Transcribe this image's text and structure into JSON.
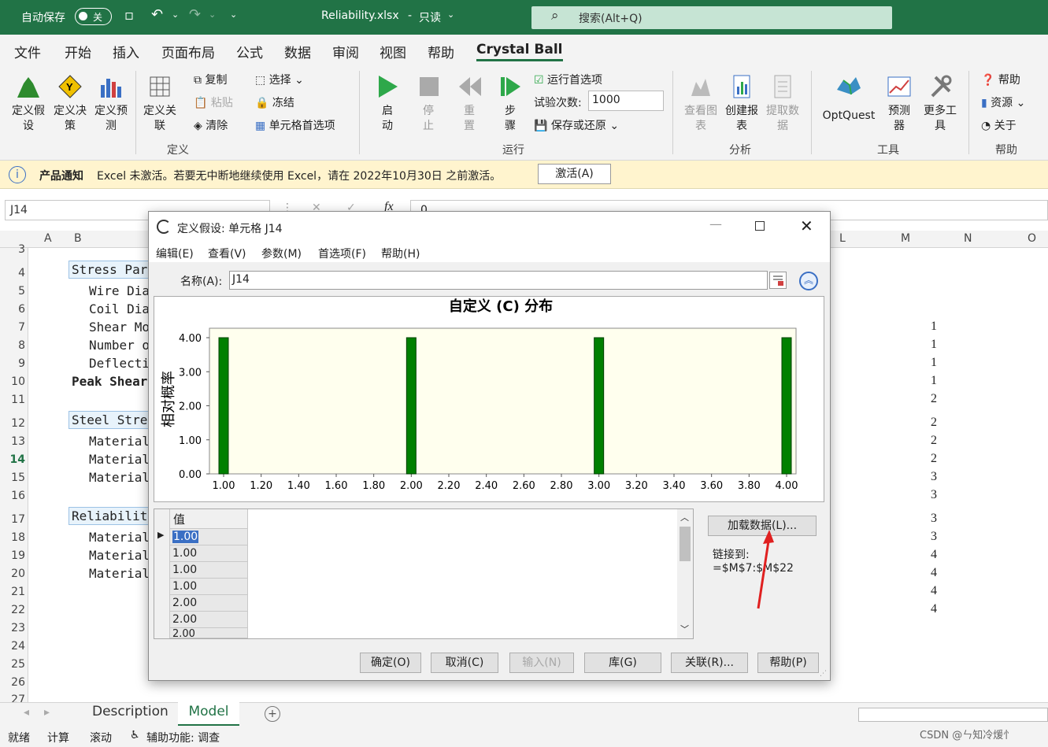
{
  "titlebar": {
    "autosave_label": "自动保存",
    "autosave_state": "关",
    "filename": "Reliability.xlsx",
    "separator": "-",
    "readonly": "只读",
    "search_placeholder": "搜索(Alt+Q)"
  },
  "menu": [
    "文件",
    "开始",
    "插入",
    "页面布局",
    "公式",
    "数据",
    "审阅",
    "视图",
    "帮助",
    "Crystal Ball"
  ],
  "ribbon": {
    "define": {
      "btn1": "定义假设",
      "btn1b": "设",
      "btn2": "定义决策",
      "btn3": "定义预测",
      "btn4": "定义关联",
      "copy": "复制",
      "paste": "粘贴",
      "clear": "清除",
      "select": "选择",
      "freeze": "冻结",
      "cellprefs": "单元格首选项",
      "group": "定义"
    },
    "run": {
      "start": "启动",
      "stop": "停止",
      "reset": "重置",
      "step": "步骤",
      "runprefs": "运行首选项",
      "trials_label": "试验次数:",
      "trials_value": "1000",
      "saverestore": "保存或还原",
      "group": "运行"
    },
    "analyze": {
      "view": "查看图表",
      "create": "创建报表",
      "extract": "提取数据",
      "group": "分析"
    },
    "tools": {
      "optquest": "OptQuest",
      "predictor": "预测器",
      "more": "更多工具",
      "group": "工具"
    },
    "help": {
      "help": "帮助",
      "resources": "资源",
      "about": "关于",
      "group": "帮助"
    }
  },
  "notice": {
    "title": "产品通知",
    "text": "Excel 未激活。若要无中断地继续使用 Excel，请在 2022年10月30日 之前激活。",
    "button": "激活(A)"
  },
  "formula": {
    "namebox": "J14",
    "fx": "fx",
    "value": "0"
  },
  "columns": [
    "A",
    "B",
    "L",
    "M",
    "N",
    "O"
  ],
  "rows": [
    "3",
    "4",
    "5",
    "6",
    "7",
    "8",
    "9",
    "10",
    "11",
    "12",
    "13",
    "14",
    "15",
    "16",
    "17",
    "18",
    "19",
    "20",
    "21",
    "22",
    "23",
    "24",
    "25",
    "26",
    "27"
  ],
  "cells": {
    "r4": "Stress Par",
    "r5": "Wire Dia",
    "r6": "Coil Dia",
    "r7": "Shear Mo",
    "r8": "Number o",
    "r9": "Deflecti",
    "r10": "Peak Shear",
    "r12": "Steel Stre",
    "r13": "Material",
    "r14": "Material",
    "r15": "Material",
    "r17": "Reliabilit",
    "r18": "Material",
    "r19": "Material",
    "r20": "Material"
  },
  "col_m_values": [
    "1",
    "1",
    "1",
    "1",
    "2",
    "2",
    "2",
    "2",
    "3",
    "3",
    "3",
    "3",
    "4",
    "4",
    "4",
    "4"
  ],
  "sheets": {
    "s1": "Description",
    "s2": "Model"
  },
  "status": {
    "ready": "就绪",
    "calc": "计算",
    "scroll": "滚动",
    "access": "辅助功能: 调查",
    "watermark": "CSDN @ㄣ知冷煖忄"
  },
  "dialog": {
    "title": "定义假设: 单元格 J14",
    "menu": [
      "编辑(E)",
      "查看(V)",
      "参数(M)",
      "首选项(F)",
      "帮助(H)"
    ],
    "name_label": "名称(A):",
    "name_value": "J14",
    "load_button": "加载数据(L)...",
    "linked_label": "链接到:",
    "linked_value": "=$M$7:$M$22",
    "grid_header": "值",
    "grid_values": [
      "1.00",
      "1.00",
      "1.00",
      "1.00",
      "2.00",
      "2.00",
      "2.00"
    ],
    "buttons": {
      "ok": "确定(O)",
      "cancel": "取消(C)",
      "enter": "输入(N)",
      "gallery": "库(G)",
      "correlate": "关联(R)...",
      "help": "帮助(P)"
    }
  },
  "chart_data": {
    "type": "bar",
    "title": "自定义 (C) 分布",
    "ylabel": "相对概率",
    "xlim": [
      1.0,
      4.0
    ],
    "ylim": [
      0,
      4
    ],
    "x_ticks": [
      "1.00",
      "1.20",
      "1.40",
      "1.60",
      "1.80",
      "2.00",
      "2.20",
      "2.40",
      "2.60",
      "2.80",
      "3.00",
      "3.20",
      "3.40",
      "3.60",
      "3.80",
      "4.00"
    ],
    "y_ticks": [
      "0.00",
      "1.00",
      "2.00",
      "3.00",
      "4.00"
    ],
    "x": [
      1.0,
      2.0,
      3.0,
      4.0
    ],
    "values": [
      4,
      4,
      4,
      4
    ],
    "bar_color": "#008000",
    "plot_bg": "#ffffee"
  }
}
